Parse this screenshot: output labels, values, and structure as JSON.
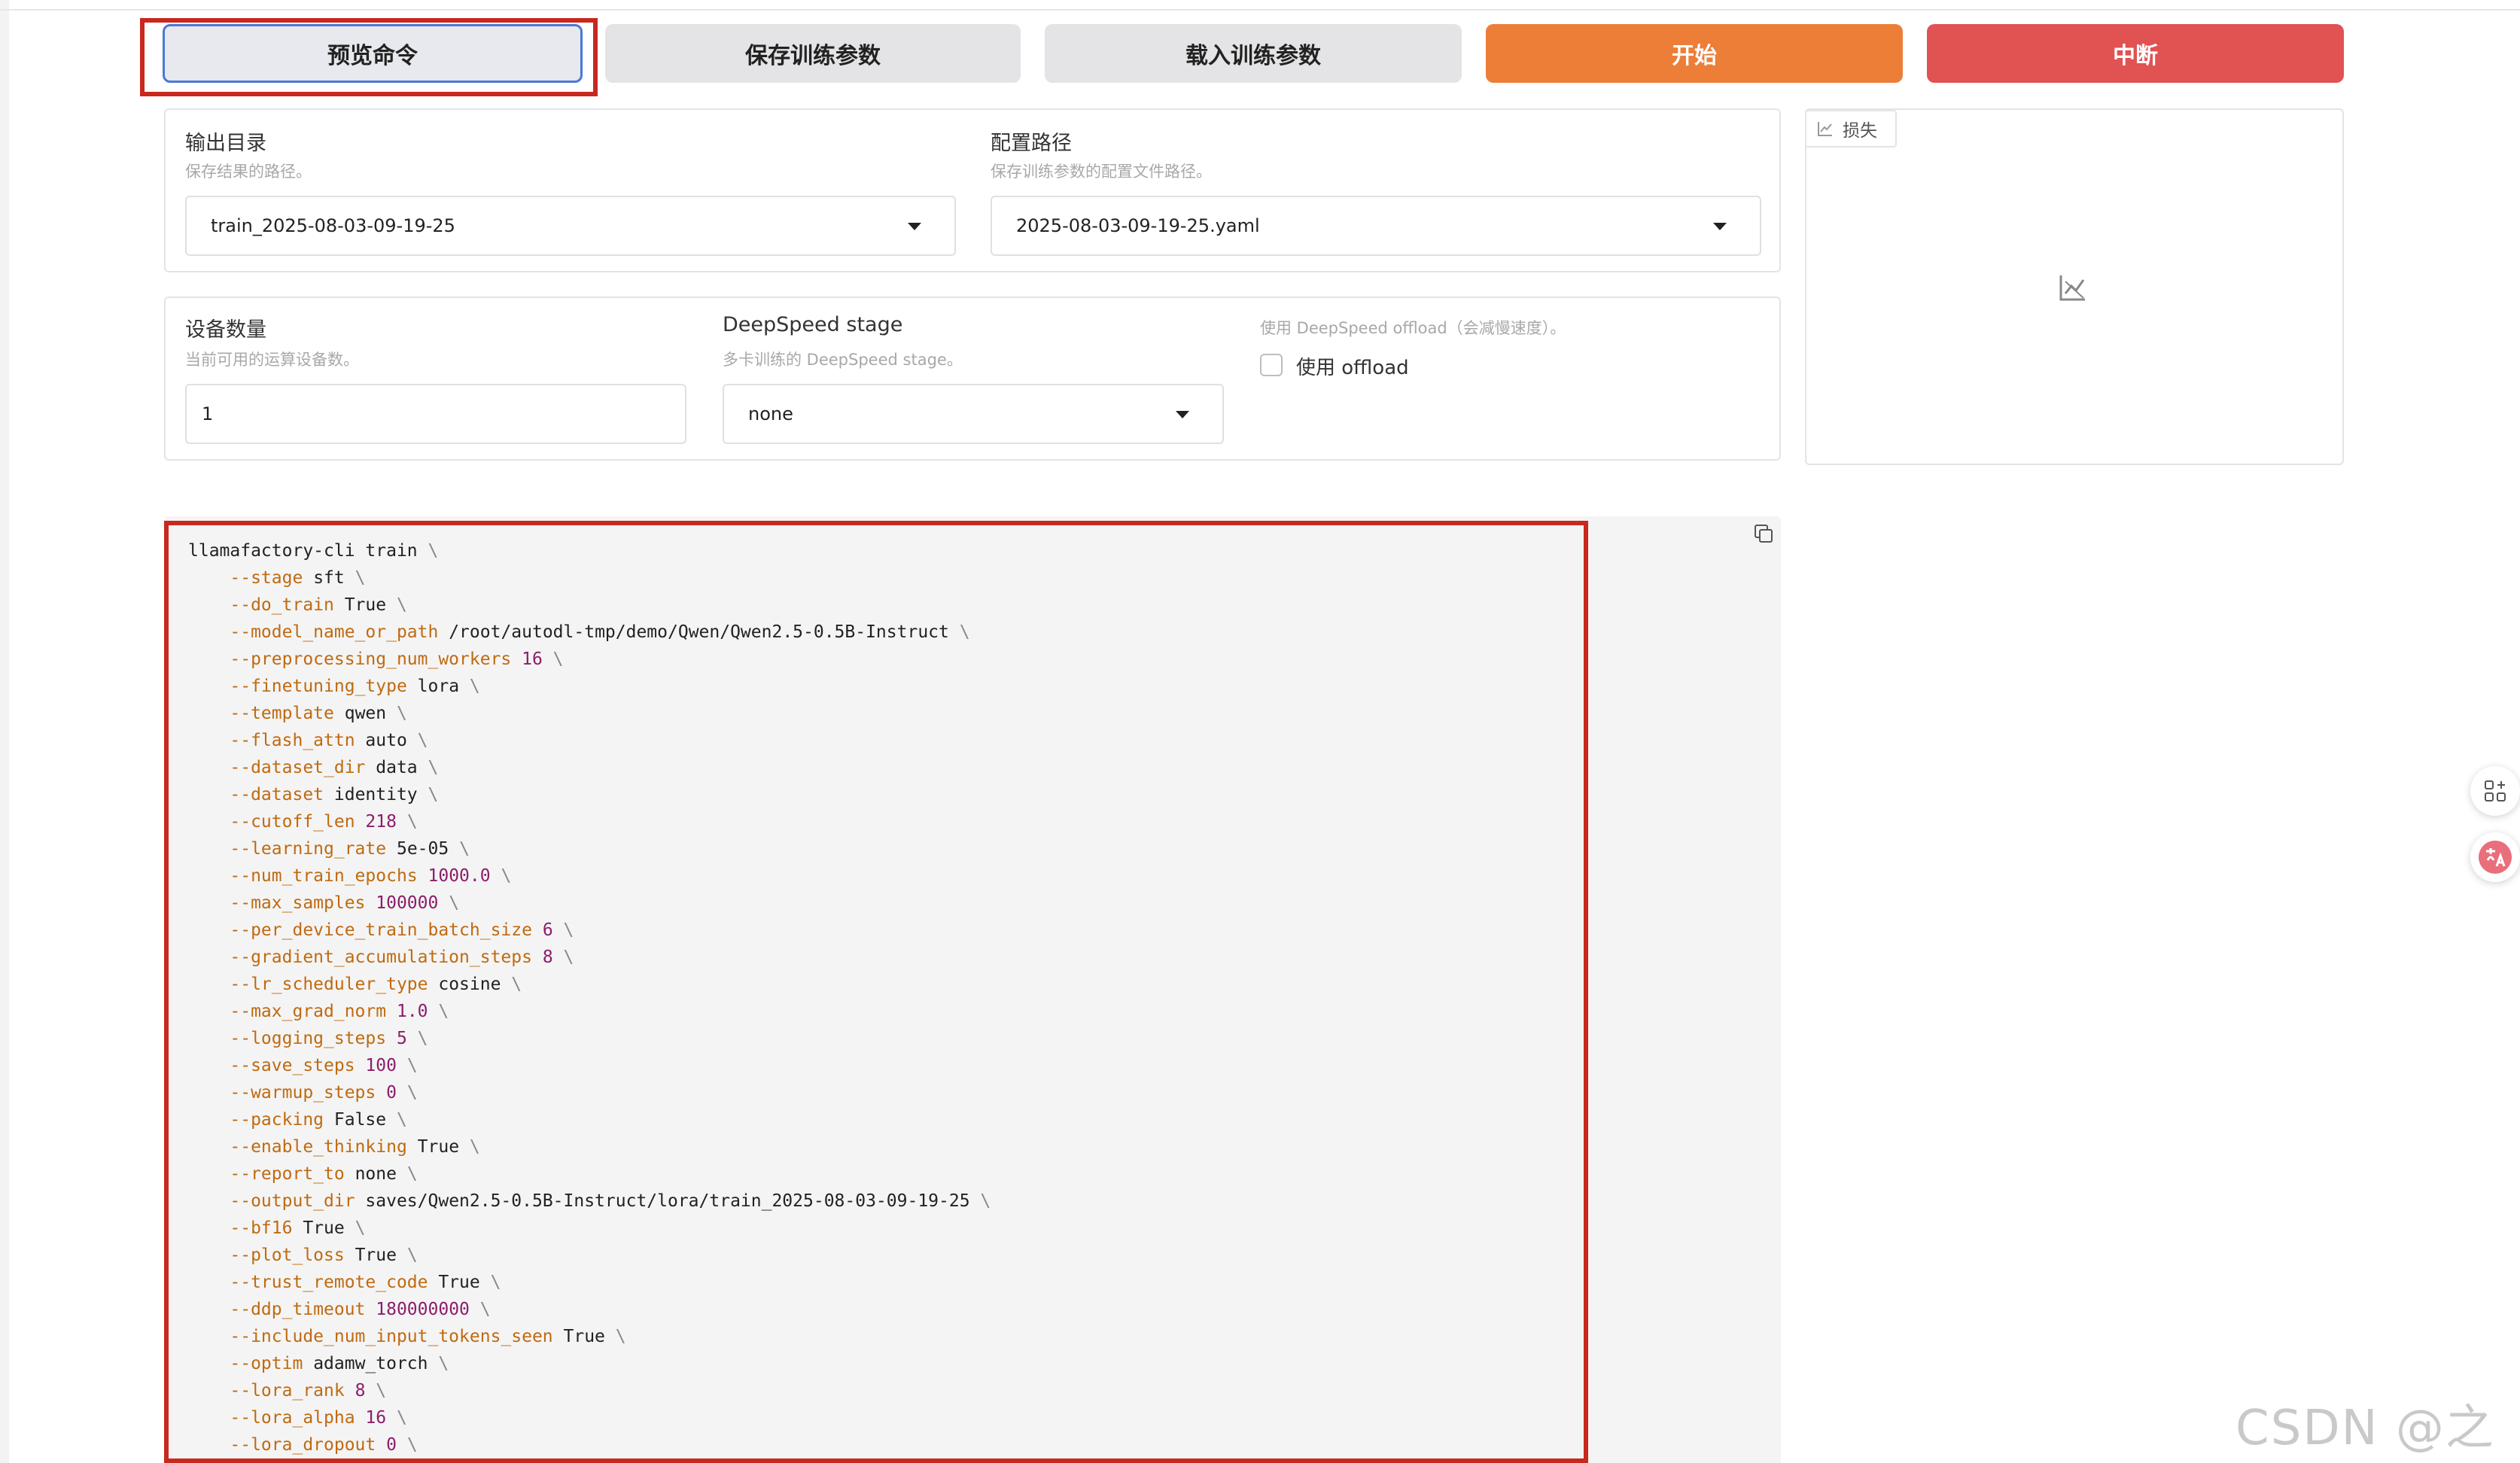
{
  "toolbar": {
    "preview_label": "预览命令",
    "save_label": "保存训练参数",
    "load_label": "载入训练参数",
    "start_label": "开始",
    "abort_label": "中断"
  },
  "output": {
    "label": "输出目录",
    "info": "保存结果的路径。",
    "value": "train_2025-08-03-09-19-25"
  },
  "config": {
    "label": "配置路径",
    "info": "保存训练参数的配置文件路径。",
    "value": "2025-08-03-09-19-25.yaml"
  },
  "devices": {
    "label": "设备数量",
    "info": "当前可用的运算设备数。",
    "value": "1"
  },
  "ds_stage": {
    "label": "DeepSpeed stage",
    "info": "多卡训练的 DeepSpeed stage。",
    "value": "none"
  },
  "ds_offload": {
    "info": "使用 DeepSpeed offload（会减慢速度）。",
    "label": "使用 offload"
  },
  "loss": {
    "tab_label": "损失"
  },
  "command": {
    "head": "llamafactory-cli train",
    "args": [
      {
        "flag": "--stage",
        "value": "sft",
        "numeric": false
      },
      {
        "flag": "--do_train",
        "value": "True",
        "numeric": false
      },
      {
        "flag": "--model_name_or_path",
        "value": "/root/autodl-tmp/demo/Qwen/Qwen2.5-0.5B-Instruct",
        "numeric": false
      },
      {
        "flag": "--preprocessing_num_workers",
        "value": "16",
        "numeric": true
      },
      {
        "flag": "--finetuning_type",
        "value": "lora",
        "numeric": false
      },
      {
        "flag": "--template",
        "value": "qwen",
        "numeric": false
      },
      {
        "flag": "--flash_attn",
        "value": "auto",
        "numeric": false
      },
      {
        "flag": "--dataset_dir",
        "value": "data",
        "numeric": false
      },
      {
        "flag": "--dataset",
        "value": "identity",
        "numeric": false
      },
      {
        "flag": "--cutoff_len",
        "value": "218",
        "numeric": true
      },
      {
        "flag": "--learning_rate",
        "value": "5e-05",
        "numeric": false
      },
      {
        "flag": "--num_train_epochs",
        "value": "1000.0",
        "numeric": true
      },
      {
        "flag": "--max_samples",
        "value": "100000",
        "numeric": true
      },
      {
        "flag": "--per_device_train_batch_size",
        "value": "6",
        "numeric": true
      },
      {
        "flag": "--gradient_accumulation_steps",
        "value": "8",
        "numeric": true
      },
      {
        "flag": "--lr_scheduler_type",
        "value": "cosine",
        "numeric": false
      },
      {
        "flag": "--max_grad_norm",
        "value": "1.0",
        "numeric": true
      },
      {
        "flag": "--logging_steps",
        "value": "5",
        "numeric": true
      },
      {
        "flag": "--save_steps",
        "value": "100",
        "numeric": true
      },
      {
        "flag": "--warmup_steps",
        "value": "0",
        "numeric": true
      },
      {
        "flag": "--packing",
        "value": "False",
        "numeric": false
      },
      {
        "flag": "--enable_thinking",
        "value": "True",
        "numeric": false
      },
      {
        "flag": "--report_to",
        "value": "none",
        "numeric": false
      },
      {
        "flag": "--output_dir",
        "value": "saves/Qwen2.5-0.5B-Instruct/lora/train_2025-08-03-09-19-25",
        "numeric": false
      },
      {
        "flag": "--bf16",
        "value": "True",
        "numeric": false
      },
      {
        "flag": "--plot_loss",
        "value": "True",
        "numeric": false
      },
      {
        "flag": "--trust_remote_code",
        "value": "True",
        "numeric": false
      },
      {
        "flag": "--ddp_timeout",
        "value": "180000000",
        "numeric": true
      },
      {
        "flag": "--include_num_input_tokens_seen",
        "value": "True",
        "numeric": false
      },
      {
        "flag": "--optim",
        "value": "adamw_torch",
        "numeric": false
      },
      {
        "flag": "--lora_rank",
        "value": "8",
        "numeric": true
      },
      {
        "flag": "--lora_alpha",
        "value": "16",
        "numeric": true
      },
      {
        "flag": "--lora_dropout",
        "value": "0",
        "numeric": true
      }
    ]
  },
  "watermark": "CSDN @之歆",
  "colors": {
    "start": "#ec7e38",
    "abort": "#e15252",
    "highlight_frame": "#c8281e",
    "flag": "#c06a10",
    "number": "#8c1d6b"
  }
}
